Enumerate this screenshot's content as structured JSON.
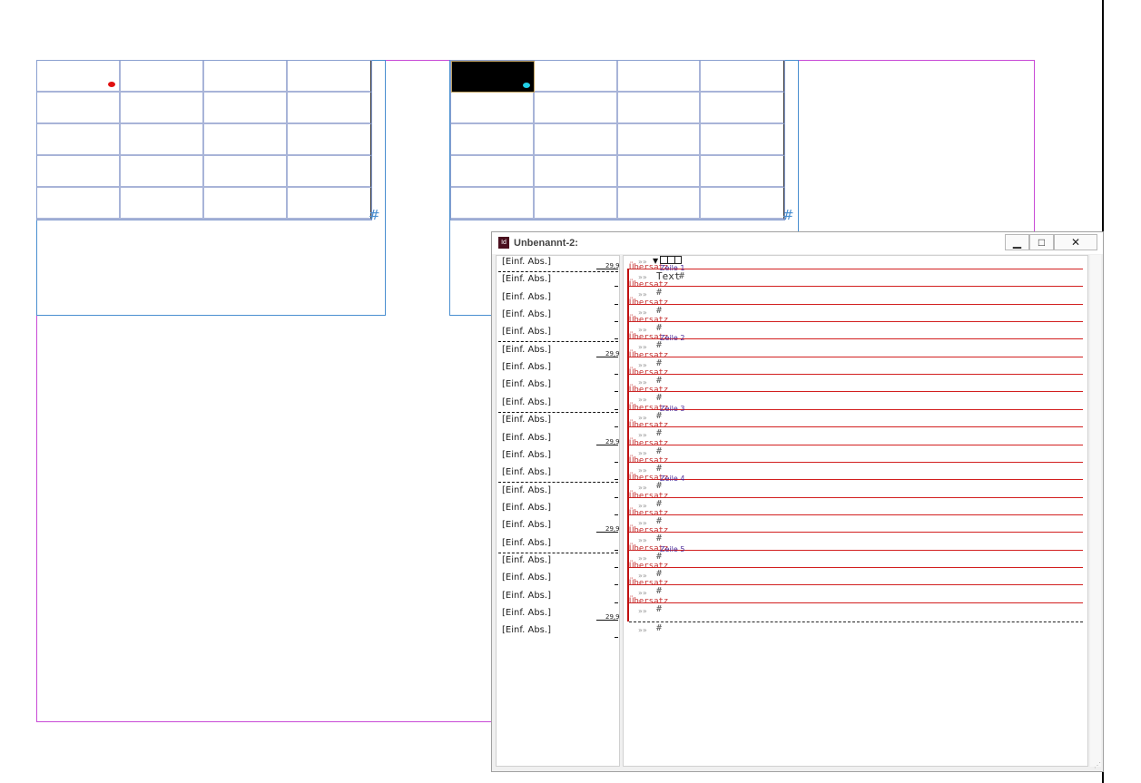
{
  "canvas": {
    "left_table": {
      "rows": 5,
      "cols": 4,
      "selected_cell": null
    },
    "right_table": {
      "rows": 5,
      "cols": 4,
      "selected_cell": [
        0,
        0
      ]
    },
    "hash_mark": "#",
    "colors": {
      "page_border": "#c84ad6",
      "frame_border": "#4a8fd0",
      "dot_red": "#e01010",
      "dot_cyan": "#22d0e8"
    }
  },
  "story_editor": {
    "title": "Unbenannt-2:",
    "app_icon": "Id",
    "buttons": {
      "minimize": "▁",
      "maximize": "□",
      "close": "✕"
    },
    "style_rows": [
      {
        "label": "[Einf. Abs.]",
        "depth": "29,9"
      },
      {
        "label": "[Einf. Abs.]",
        "depth": ""
      },
      {
        "label": "[Einf. Abs.]",
        "depth": ""
      },
      {
        "label": "[Einf. Abs.]",
        "depth": ""
      },
      {
        "label": "[Einf. Abs.]",
        "depth": ""
      },
      {
        "label": "[Einf. Abs.]",
        "depth": "29,9"
      },
      {
        "label": "[Einf. Abs.]",
        "depth": ""
      },
      {
        "label": "[Einf. Abs.]",
        "depth": ""
      },
      {
        "label": "[Einf. Abs.]",
        "depth": ""
      },
      {
        "label": "[Einf. Abs.]",
        "depth": ""
      },
      {
        "label": "[Einf. Abs.]",
        "depth": "29,9"
      },
      {
        "label": "[Einf. Abs.]",
        "depth": ""
      },
      {
        "label": "[Einf. Abs.]",
        "depth": ""
      },
      {
        "label": "[Einf. Abs.]",
        "depth": ""
      },
      {
        "label": "[Einf. Abs.]",
        "depth": ""
      },
      {
        "label": "[Einf. Abs.]",
        "depth": "29,9"
      },
      {
        "label": "[Einf. Abs.]",
        "depth": ""
      },
      {
        "label": "[Einf. Abs.]",
        "depth": ""
      },
      {
        "label": "[Einf. Abs.]",
        "depth": ""
      },
      {
        "label": "[Einf. Abs.]",
        "depth": ""
      },
      {
        "label": "[Einf. Abs.]",
        "depth": "29,9"
      },
      {
        "label": "[Einf. Abs.]",
        "depth": ""
      }
    ],
    "overset_label": "Übersatz",
    "row_labels": [
      "Zeile 1",
      "Zeile 2",
      "Zeile 3",
      "Zeile 4",
      "Zeile 5"
    ],
    "first_text": "Text",
    "chevron": "»»",
    "hash": "#"
  }
}
